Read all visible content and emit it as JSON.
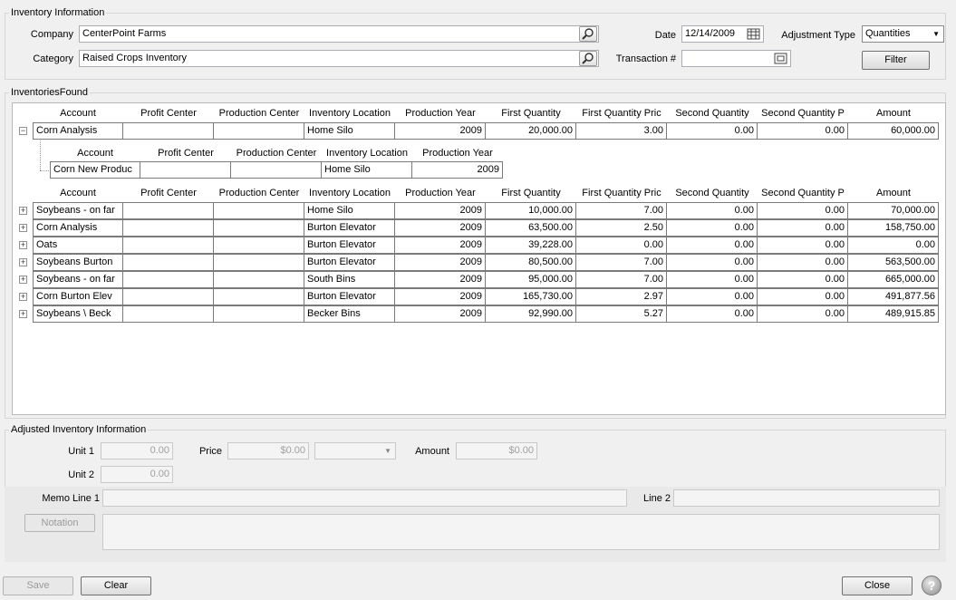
{
  "inventory_info": {
    "legend": "Inventory Information",
    "company_label": "Company",
    "company_value": "CenterPoint Farms",
    "category_label": "Category",
    "category_value": "Raised Crops Inventory",
    "date_label": "Date",
    "date_value": "12/14/2009",
    "transaction_label": "Transaction #",
    "transaction_value": "",
    "adjustment_type_label": "Adjustment Type",
    "adjustment_type_value": "Quantities",
    "filter_label": "Filter"
  },
  "inventories_found": {
    "legend": "InventoriesFound",
    "columns": [
      "Account",
      "Profit Center",
      "Production Center",
      "Inventory Location",
      "Production Year",
      "First Quantity",
      "First Quantity Pric",
      "Second Quantity",
      "Second Quantity P",
      "Amount"
    ],
    "expanded_row": {
      "account": "Corn Analysis",
      "profit_center": "",
      "production_center": "",
      "location": "Home Silo",
      "year": "2009",
      "first_qty": "20,000.00",
      "first_price": "3.00",
      "second_qty": "0.00",
      "second_price": "0.00",
      "amount": "60,000.00"
    },
    "child_columns": [
      "Account",
      "Profit Center",
      "Production Center",
      "Inventory Location",
      "Production Year"
    ],
    "child_row": {
      "account": "Corn New Produc",
      "profit_center": "",
      "production_center": "",
      "location": "Home Silo",
      "year": "2009"
    },
    "rows": [
      {
        "account": "Soybeans - on far",
        "profit_center": "",
        "production_center": "",
        "location": "Home Silo",
        "year": "2009",
        "first_qty": "10,000.00",
        "first_price": "7.00",
        "second_qty": "0.00",
        "second_price": "0.00",
        "amount": "70,000.00"
      },
      {
        "account": "Corn Analysis",
        "profit_center": "",
        "production_center": "",
        "location": "Burton Elevator",
        "year": "2009",
        "first_qty": "63,500.00",
        "first_price": "2.50",
        "second_qty": "0.00",
        "second_price": "0.00",
        "amount": "158,750.00"
      },
      {
        "account": "Oats",
        "profit_center": "",
        "production_center": "",
        "location": "Burton Elevator",
        "year": "2009",
        "first_qty": "39,228.00",
        "first_price": "0.00",
        "second_qty": "0.00",
        "second_price": "0.00",
        "amount": "0.00"
      },
      {
        "account": "Soybeans Burton",
        "profit_center": "",
        "production_center": "",
        "location": "Burton Elevator",
        "year": "2009",
        "first_qty": "80,500.00",
        "first_price": "7.00",
        "second_qty": "0.00",
        "second_price": "0.00",
        "amount": "563,500.00"
      },
      {
        "account": "Soybeans - on far",
        "profit_center": "",
        "production_center": "",
        "location": "South Bins",
        "year": "2009",
        "first_qty": "95,000.00",
        "first_price": "7.00",
        "second_qty": "0.00",
        "second_price": "0.00",
        "amount": "665,000.00"
      },
      {
        "account": "Corn Burton Elev",
        "profit_center": "",
        "production_center": "",
        "location": "Burton Elevator",
        "year": "2009",
        "first_qty": "165,730.00",
        "first_price": "2.97",
        "second_qty": "0.00",
        "second_price": "0.00",
        "amount": "491,877.56"
      },
      {
        "account": "Soybeans \\ Beck",
        "profit_center": "",
        "production_center": "",
        "location": "Becker Bins",
        "year": "2009",
        "first_qty": "92,990.00",
        "first_price": "5.27",
        "second_qty": "0.00",
        "second_price": "0.00",
        "amount": "489,915.85"
      }
    ]
  },
  "adjusted": {
    "legend": "Adjusted Inventory Information",
    "unit1_label": "Unit 1",
    "unit1_value": "0.00",
    "unit2_label": "Unit 2",
    "unit2_value": "0.00",
    "price_label": "Price",
    "price_value": "$0.00",
    "price_unit_value": "",
    "amount_label": "Amount",
    "amount_value": "$0.00"
  },
  "memo": {
    "memo1_label": "Memo Line 1",
    "memo1_value": "",
    "line2_label": "Line 2",
    "line2_value": "",
    "notation_label": "Notation",
    "notation_value": ""
  },
  "footer": {
    "save_label": "Save",
    "clear_label": "Clear",
    "close_label": "Close",
    "help_glyph": "?"
  },
  "icons": {
    "company_lookup": "magnifier-icon",
    "category_lookup": "magnifier-icon",
    "date_picker": "calendar-icon",
    "transaction_lookup": "list-icon",
    "help": "help-icon"
  }
}
